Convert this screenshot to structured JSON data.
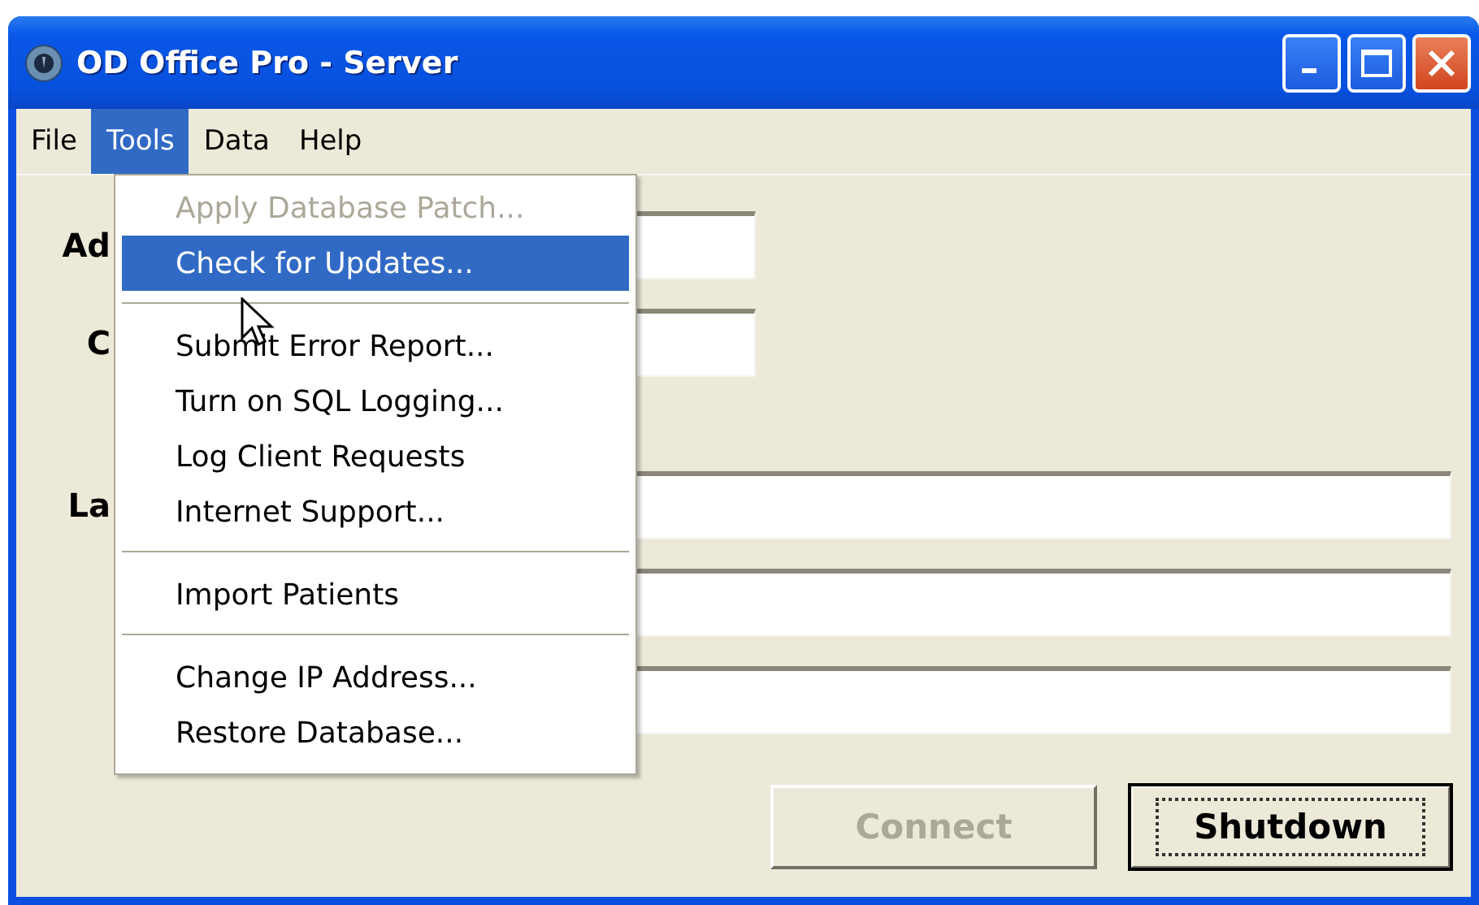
{
  "window": {
    "title": "OD Office Pro - Server"
  },
  "menu_bar": [
    {
      "label": "File",
      "selected": false
    },
    {
      "label": "Tools",
      "selected": true
    },
    {
      "label": "Data",
      "selected": false
    },
    {
      "label": "Help",
      "selected": false
    }
  ],
  "open_menu": {
    "items": [
      {
        "kind": "item",
        "label": "Apply Database Patch...",
        "disabled": true,
        "selected": false
      },
      {
        "kind": "item",
        "label": "Check for Updates...",
        "disabled": false,
        "selected": true
      },
      {
        "kind": "separator"
      },
      {
        "kind": "item",
        "label": "Submit Error Report...",
        "disabled": false,
        "selected": false
      },
      {
        "kind": "item",
        "label": "Turn on SQL Logging...",
        "disabled": false,
        "selected": false
      },
      {
        "kind": "item",
        "label": "Log Client Requests",
        "disabled": false,
        "selected": false
      },
      {
        "kind": "item",
        "label": "Internet Support...",
        "disabled": false,
        "selected": false
      },
      {
        "kind": "separator"
      },
      {
        "kind": "item",
        "label": "Import Patients",
        "disabled": false,
        "selected": false
      },
      {
        "kind": "separator"
      },
      {
        "kind": "item",
        "label": "Change IP Address...",
        "disabled": false,
        "selected": false
      },
      {
        "kind": "item",
        "label": "Restore Database...",
        "disabled": false,
        "selected": false
      }
    ]
  },
  "form": {
    "rows": [
      {
        "label": "Ad",
        "kind": "short"
      },
      {
        "label": "C",
        "kind": "short"
      },
      {
        "label": "La",
        "kind": "long"
      },
      {
        "kind": "long"
      },
      {
        "kind": "long"
      }
    ]
  },
  "buttons": [
    {
      "label": "Connect",
      "disabled": true,
      "default": false
    },
    {
      "label": "Shutdown",
      "disabled": false,
      "default": true
    }
  ]
}
